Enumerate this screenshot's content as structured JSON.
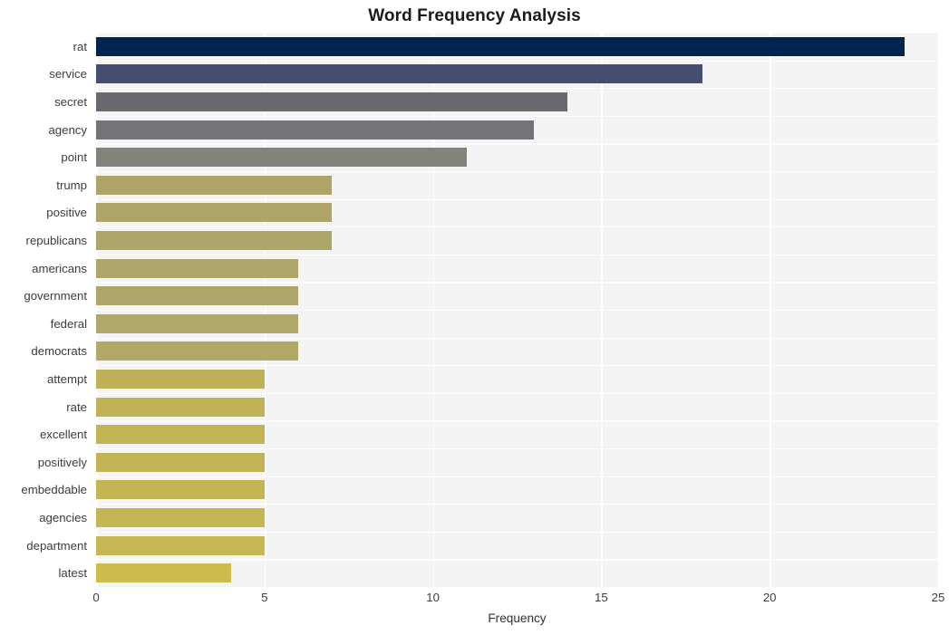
{
  "chart_data": {
    "type": "bar",
    "orientation": "horizontal",
    "title": "Word Frequency Analysis",
    "xlabel": "Frequency",
    "ylabel": "",
    "xlim": [
      0,
      25
    ],
    "ylim_categories_order": "descending by value",
    "xticks": [
      0,
      5,
      10,
      15,
      20,
      25
    ],
    "xtick_labels": [
      "0",
      "5",
      "10",
      "15",
      "20",
      "25"
    ],
    "grid": true,
    "grid_color": "#ffffff",
    "plot_background": "#f4f4f5",
    "figure_background": "#ffffff",
    "legend": null,
    "categories": [
      "rat",
      "service",
      "secret",
      "agency",
      "point",
      "trump",
      "positive",
      "republicans",
      "americans",
      "government",
      "federal",
      "democrats",
      "attempt",
      "rate",
      "excellent",
      "positively",
      "embeddable",
      "agencies",
      "department",
      "latest"
    ],
    "values": [
      24,
      18,
      14,
      13,
      11,
      7,
      7,
      7,
      6,
      6,
      6,
      6,
      5,
      5,
      5,
      5,
      5,
      5,
      5,
      4
    ],
    "bar_colors": [
      "#00244f",
      "#454f72",
      "#696a70",
      "#747478",
      "#84837b",
      "#aea46a",
      "#ada569",
      "#ada669",
      "#aea76a",
      "#afa769",
      "#b0a868",
      "#b0a967",
      "#c0b158",
      "#c1b257",
      "#c2b356",
      "#c2b455",
      "#c3b554",
      "#c4b653",
      "#c5b752",
      "#ccbc4c"
    ]
  },
  "title": {
    "text": "Word Frequency Analysis"
  },
  "axes": {
    "x_label": "Frequency"
  }
}
